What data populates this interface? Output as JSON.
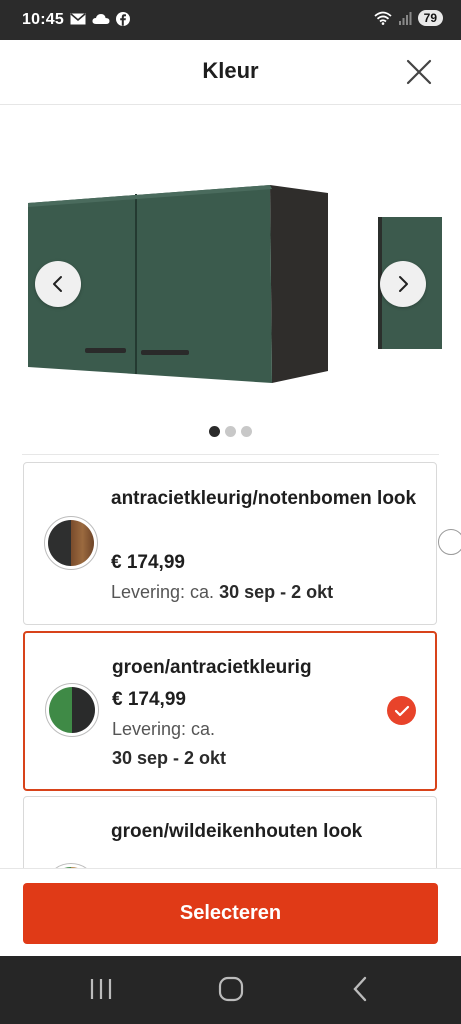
{
  "statusbar": {
    "time": "10:45",
    "battery": "79"
  },
  "header": {
    "title": "Kleur"
  },
  "carousel": {
    "dots": 3,
    "active_index": 0
  },
  "colors": {
    "accent": "#e03a17",
    "selected_border": "#d8431a",
    "cabinet_green": "#3b5b4d",
    "cabinet_dark": "#2f2d2b"
  },
  "options": [
    {
      "name": "antracietkleurig/notenbomen look",
      "price": "€ 174,99",
      "delivery_label": "Levering: ca.",
      "delivery_dates": "30 sep - 2 okt",
      "swatch": [
        "#2e2f2f",
        "#8a5a34"
      ],
      "selected": false
    },
    {
      "name": "groen/antracietkleurig",
      "price": "€ 174,99",
      "delivery_label": "Levering: ca.",
      "delivery_dates": "30 sep - 2 okt",
      "swatch": [
        "#3f8a46",
        "#2a2b2b"
      ],
      "selected": true
    },
    {
      "name": "groen/wildeikenhouten look",
      "swatch": [
        "#3f8a46",
        "#b48850"
      ],
      "selected": false
    }
  ],
  "cta": {
    "label": "Selecteren"
  },
  "icons": [
    "mail-icon",
    "cloud-icon",
    "facebook-icon",
    "wifi-icon",
    "signal-icon",
    "close-icon",
    "chevron-left-icon",
    "chevron-right-icon",
    "checkmark-icon",
    "recents-icon",
    "home-icon",
    "back-icon"
  ]
}
